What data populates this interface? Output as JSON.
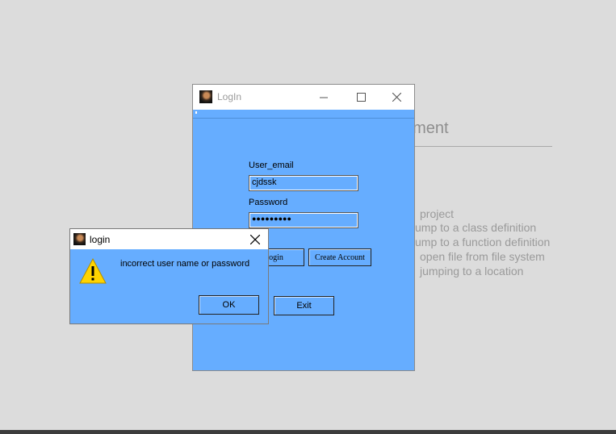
{
  "background": {
    "title": "ument",
    "paren": ")",
    "lines": [
      "project",
      "ump to a class definition",
      "ump to a function definition",
      "open file from file system",
      "jumping to a location"
    ]
  },
  "login_window": {
    "title": "LogIn",
    "email_label": "User_email",
    "email_value": "cjdssk",
    "password_label": "Password",
    "password_value": "●●●●●●●●●",
    "login_button": "Login",
    "create_account_button": "Create Account",
    "exit_button": "Exit"
  },
  "error_dialog": {
    "title": "login",
    "message": "incorrect user name or password",
    "ok_button": "OK"
  },
  "colors": {
    "window_bg": "#66adff",
    "desktop_bg": "#dcdcdc"
  }
}
